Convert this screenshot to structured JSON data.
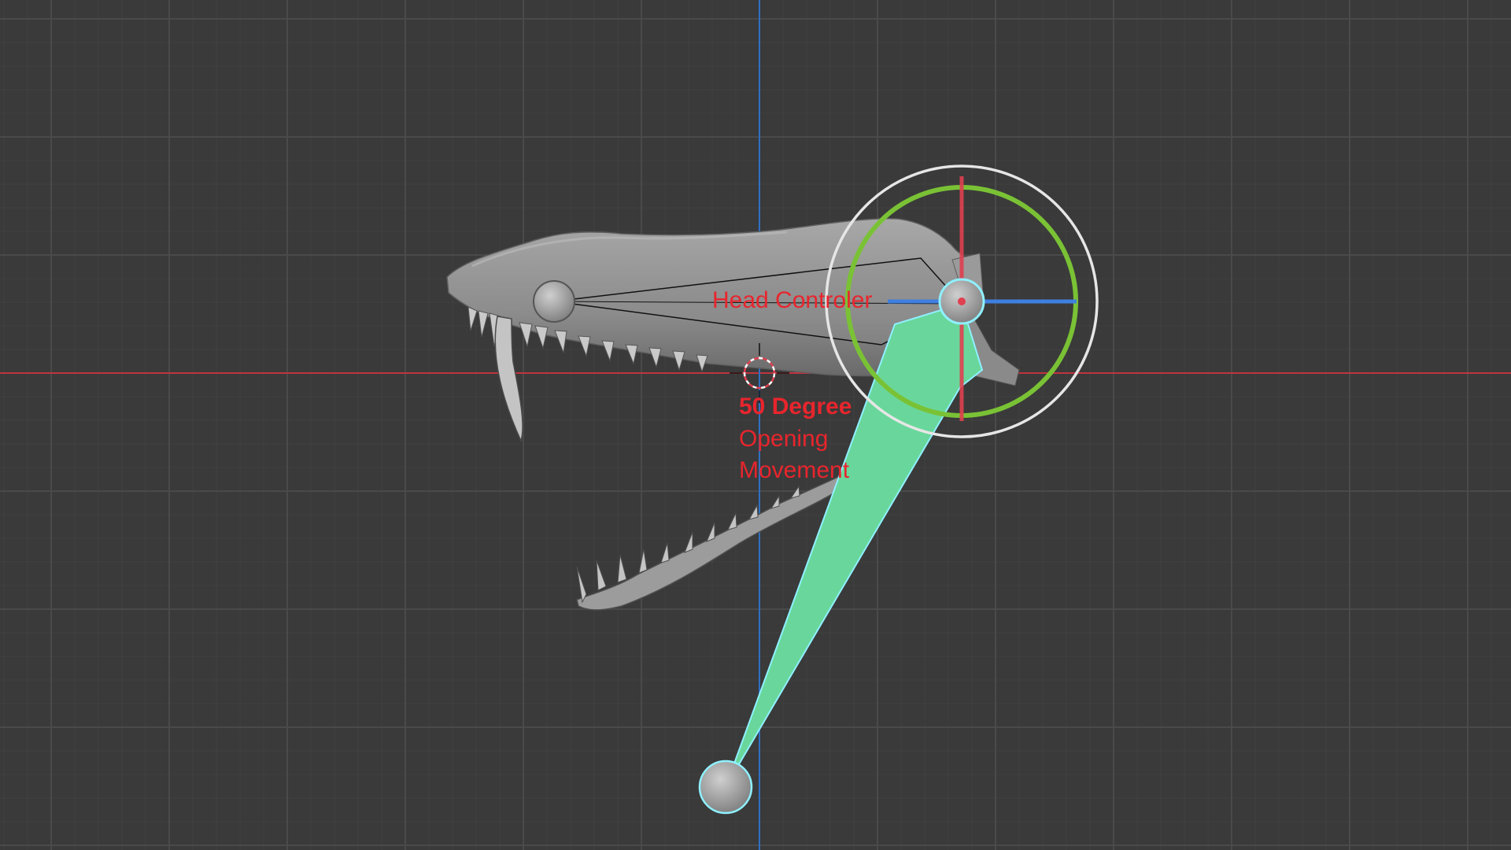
{
  "viewport": {
    "background_color": "#3a3a3a",
    "grid_color": "#4c4c4c",
    "x_axis_color": "#c0343f",
    "y_axis_color": "#2f6fc4"
  },
  "annotations": {
    "head_controller": "Head Controler",
    "degree": "50 Degree",
    "opening": "Opening",
    "movement": "Movement",
    "text_color": "#e8252d"
  },
  "gizmo": {
    "outer_ring_color": "#e6e6e6",
    "rotation_ring_color": "#7ac235",
    "x_handle_color": "#e04050",
    "z_handle_color": "#3f7fe0"
  },
  "bone": {
    "fill_color": "#69d79b",
    "outline_color": "#8ff0ff"
  },
  "icons": [
    "3d-cursor-icon",
    "bone-joint-icon",
    "transform-gizmo-icon"
  ]
}
